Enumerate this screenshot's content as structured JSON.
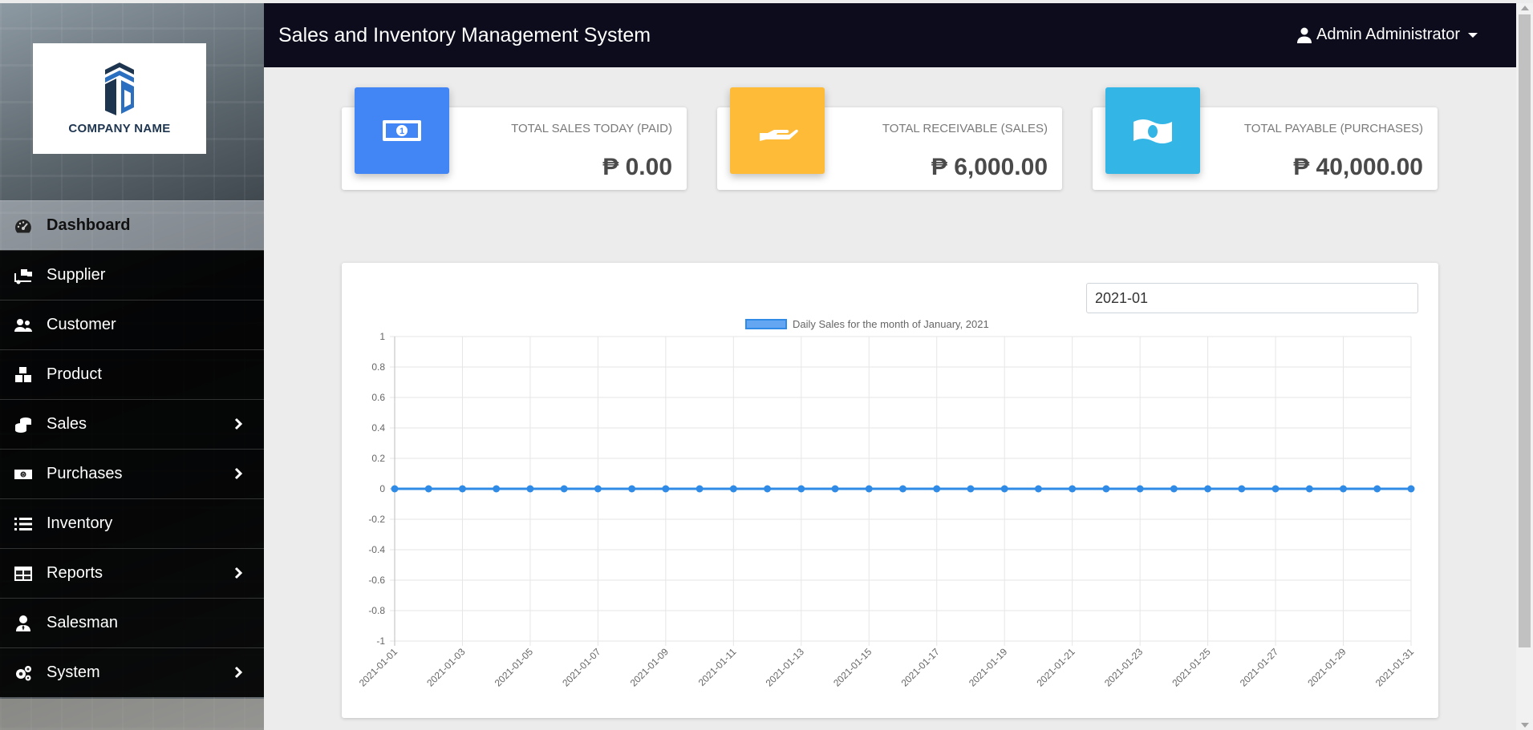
{
  "sidebar": {
    "company_name": "COMPANY NAME",
    "items": [
      {
        "label": "Dashboard",
        "icon": "tachometer-icon",
        "active": true,
        "has_submenu": false
      },
      {
        "label": "Supplier",
        "icon": "truck-loading-icon",
        "active": false,
        "has_submenu": false
      },
      {
        "label": "Customer",
        "icon": "users-icon",
        "active": false,
        "has_submenu": false
      },
      {
        "label": "Product",
        "icon": "boxes-icon",
        "active": false,
        "has_submenu": false
      },
      {
        "label": "Sales",
        "icon": "coins-icon",
        "active": false,
        "has_submenu": true
      },
      {
        "label": "Purchases",
        "icon": "money-bill-icon",
        "active": false,
        "has_submenu": true
      },
      {
        "label": "Inventory",
        "icon": "list-icon",
        "active": false,
        "has_submenu": false
      },
      {
        "label": "Reports",
        "icon": "table-icon",
        "active": false,
        "has_submenu": true
      },
      {
        "label": "Salesman",
        "icon": "user-tie-icon",
        "active": false,
        "has_submenu": false
      },
      {
        "label": "System",
        "icon": "cogs-icon",
        "active": false,
        "has_submenu": true
      }
    ]
  },
  "header": {
    "title": "Sales and Inventory Management System",
    "user_name": "Admin Administrator"
  },
  "cards": [
    {
      "label": "TOTAL SALES TODAY (PAID)",
      "value": "₱ 0.00",
      "color": "#4286f5",
      "icon": "money-bill-icon"
    },
    {
      "label": "TOTAL RECEIVABLE (SALES)",
      "value": "₱ 6,000.00",
      "color": "#fdbb38",
      "icon": "hand-holding-icon"
    },
    {
      "label": "TOTAL PAYABLE (PURCHASES)",
      "value": "₱ 40,000.00",
      "color": "#33b6e6",
      "icon": "money-bill-wave-icon"
    }
  ],
  "chart_panel": {
    "month_value": "2021-01"
  },
  "chart_data": {
    "type": "line",
    "legend": "Daily Sales for the month of January, 2021",
    "color": "#2f8be6",
    "x": [
      "2021-01-01",
      "2021-01-02",
      "2021-01-03",
      "2021-01-04",
      "2021-01-05",
      "2021-01-06",
      "2021-01-07",
      "2021-01-08",
      "2021-01-09",
      "2021-01-10",
      "2021-01-11",
      "2021-01-12",
      "2021-01-13",
      "2021-01-14",
      "2021-01-15",
      "2021-01-16",
      "2021-01-17",
      "2021-01-18",
      "2021-01-19",
      "2021-01-20",
      "2021-01-21",
      "2021-01-22",
      "2021-01-23",
      "2021-01-24",
      "2021-01-25",
      "2021-01-26",
      "2021-01-27",
      "2021-01-28",
      "2021-01-29",
      "2021-01-30",
      "2021-01-31"
    ],
    "x_tick_labels": [
      "2021-01-01",
      "2021-01-03",
      "2021-01-05",
      "2021-01-07",
      "2021-01-09",
      "2021-01-11",
      "2021-01-13",
      "2021-01-15",
      "2021-01-17",
      "2021-01-19",
      "2021-01-21",
      "2021-01-23",
      "2021-01-25",
      "2021-01-27",
      "2021-01-29",
      "2021-01-31"
    ],
    "values": [
      0,
      0,
      0,
      0,
      0,
      0,
      0,
      0,
      0,
      0,
      0,
      0,
      0,
      0,
      0,
      0,
      0,
      0,
      0,
      0,
      0,
      0,
      0,
      0,
      0,
      0,
      0,
      0,
      0,
      0,
      0
    ],
    "y_ticks": [
      "1",
      "0.8",
      "0.6",
      "0.4",
      "0.2",
      "0",
      "-0.2",
      "-0.4",
      "-0.6",
      "-0.8",
      "-1"
    ],
    "ylim": [
      -1,
      1
    ],
    "grid": true,
    "legend_position": "top"
  }
}
